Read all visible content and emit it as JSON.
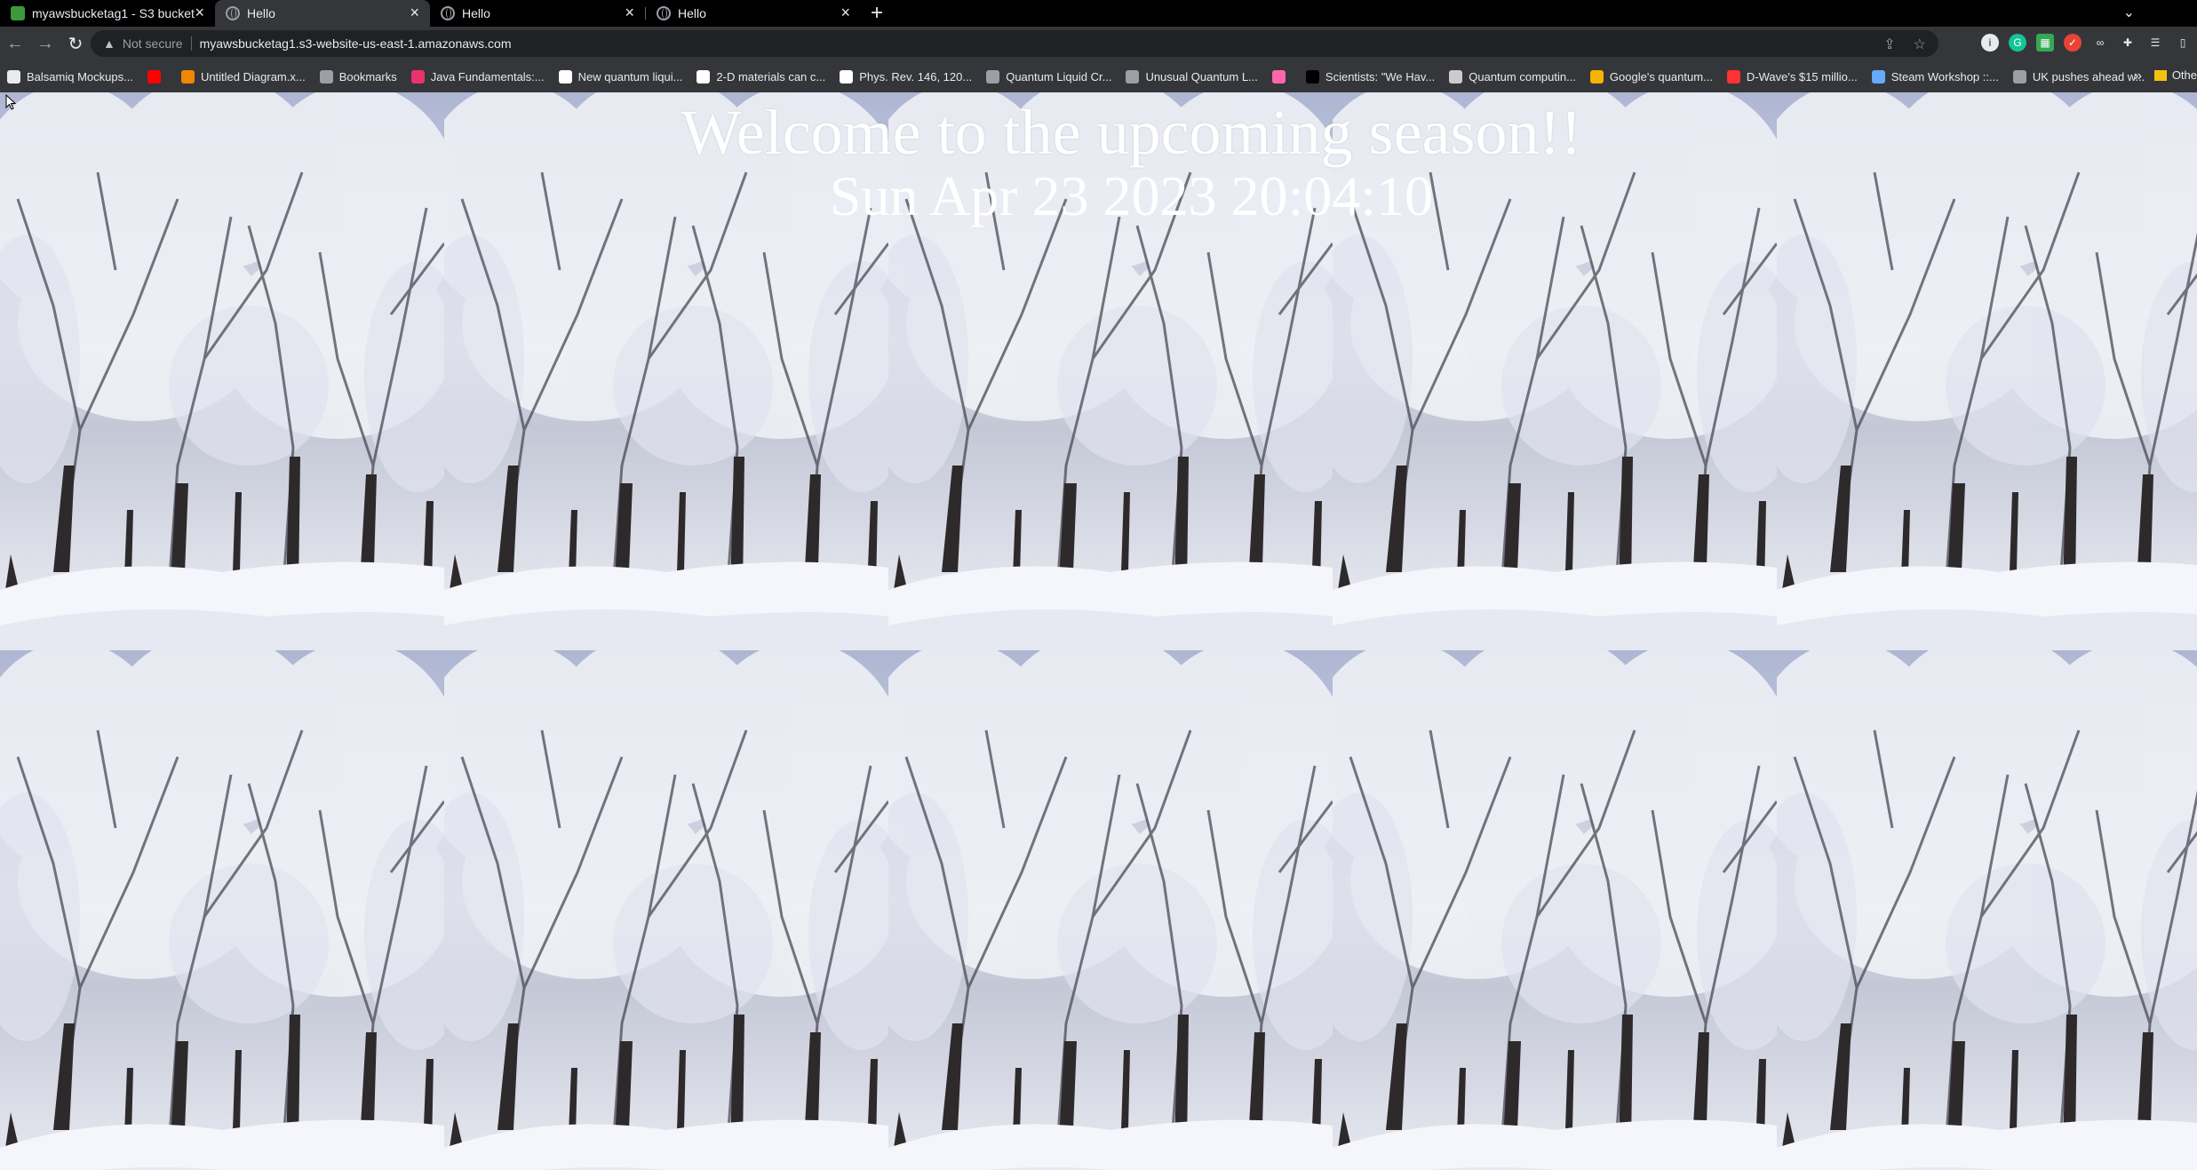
{
  "tabs": [
    {
      "title": "myawsbucketag1 - S3 bucket",
      "icon": "aws-s3-icon",
      "active": false
    },
    {
      "title": "Hello",
      "icon": "globe-icon",
      "active": true
    },
    {
      "title": "Hello",
      "icon": "globe-icon",
      "active": false
    },
    {
      "title": "Hello",
      "icon": "globe-icon",
      "active": false
    }
  ],
  "toolbar": {
    "security_label": "Not secure",
    "url": "myawsbucketag1.s3-website-us-east-1.amazonaws.com"
  },
  "bookmarks": [
    {
      "label": "Balsamiq Mockups...",
      "color": "#e8eaed"
    },
    {
      "label": "",
      "color": "#ff0000"
    },
    {
      "label": "Untitled Diagram.x...",
      "color": "#f08705"
    },
    {
      "label": "Bookmarks",
      "color": "#9aa0a6"
    },
    {
      "label": "Java Fundamentals:...",
      "color": "#e8336d"
    },
    {
      "label": "New quantum liqui...",
      "color": "#ffffff"
    },
    {
      "label": "2-D materials can c...",
      "color": "#ffffff"
    },
    {
      "label": "Phys. Rev. 146, 120...",
      "color": "#ffffff"
    },
    {
      "label": "Quantum Liquid Cr...",
      "color": "#9aa0a6"
    },
    {
      "label": "Unusual Quantum L...",
      "color": "#9aa0a6"
    },
    {
      "label": "",
      "color": "#ff66aa"
    },
    {
      "label": "Scientists: \"We Hav...",
      "color": "#000000"
    },
    {
      "label": "Quantum computin...",
      "color": "#cccccc"
    },
    {
      "label": "Google's quantum...",
      "color": "#f4b400"
    },
    {
      "label": "D-Wave's $15 millio...",
      "color": "#ff3333"
    },
    {
      "label": "Steam Workshop ::...",
      "color": "#66aaff"
    },
    {
      "label": "UK pushes ahead w...",
      "color": "#9aa0a6"
    }
  ],
  "bookmarks_other": "Othe",
  "page": {
    "heading": "Welcome to the upcoming season!!",
    "datetime": "Sun Apr 23 2023 20:04:10"
  }
}
